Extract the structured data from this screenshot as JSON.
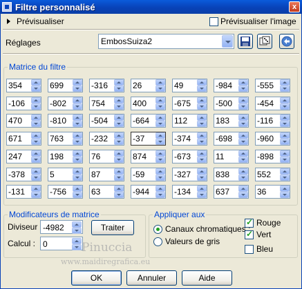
{
  "window": {
    "title": "Filtre personnalisé",
    "close_glyph": "x"
  },
  "preview": {
    "label": "Prévisualiser",
    "image_label": "Prévisualiser l'image",
    "image_checked": false
  },
  "settings": {
    "label": "Réglages",
    "preset_value": "EmbosSuiza2",
    "icons": [
      "save-icon",
      "random-dice-icon",
      "reset-icon"
    ]
  },
  "matrix": {
    "title": "Matrice du filtre",
    "rows": [
      [
        "354",
        "699",
        "-316",
        "26",
        "49",
        "-984",
        "-555"
      ],
      [
        "-106",
        "-802",
        "754",
        "400",
        "-675",
        "-500",
        "-454"
      ],
      [
        "470",
        "-810",
        "-504",
        "-664",
        "112",
        "183",
        "-116"
      ],
      [
        "671",
        "763",
        "-232",
        "-37",
        "-374",
        "-698",
        "-960"
      ],
      [
        "247",
        "198",
        "76",
        "874",
        "-673",
        "11",
        "-898"
      ],
      [
        "-378",
        "5",
        "87",
        "-59",
        "-327",
        "838",
        "552"
      ],
      [
        "-131",
        "-756",
        "63",
        "-944",
        "-134",
        "637",
        "36"
      ]
    ]
  },
  "modifiers": {
    "title": "Modificateurs de matrice",
    "divisor_label": "Diviseur :",
    "divisor_value": "-4982",
    "bias_label": "Calcul :",
    "bias_value": "0",
    "compute_button": "Traiter"
  },
  "apply": {
    "title": "Appliquer aux",
    "channels_label": "Canaux chromatiques :",
    "channels_selected": true,
    "grayscale_label": "Valeurs de gris",
    "red_label": "Rouge",
    "red_checked": true,
    "green_label": "Vert",
    "green_checked": true,
    "blue_label": "Bleu",
    "blue_checked": false
  },
  "footer": {
    "ok": "OK",
    "cancel": "Annuler",
    "help": "Aide"
  },
  "watermark": {
    "line1": "Pinuccia",
    "line2": "www.maidiregrafica.eu"
  },
  "colors": {
    "title_bar": "#0842B8",
    "group_title": "#0046D5",
    "check_green": "#21A121",
    "dialog_bg": "#ECE9D8"
  }
}
